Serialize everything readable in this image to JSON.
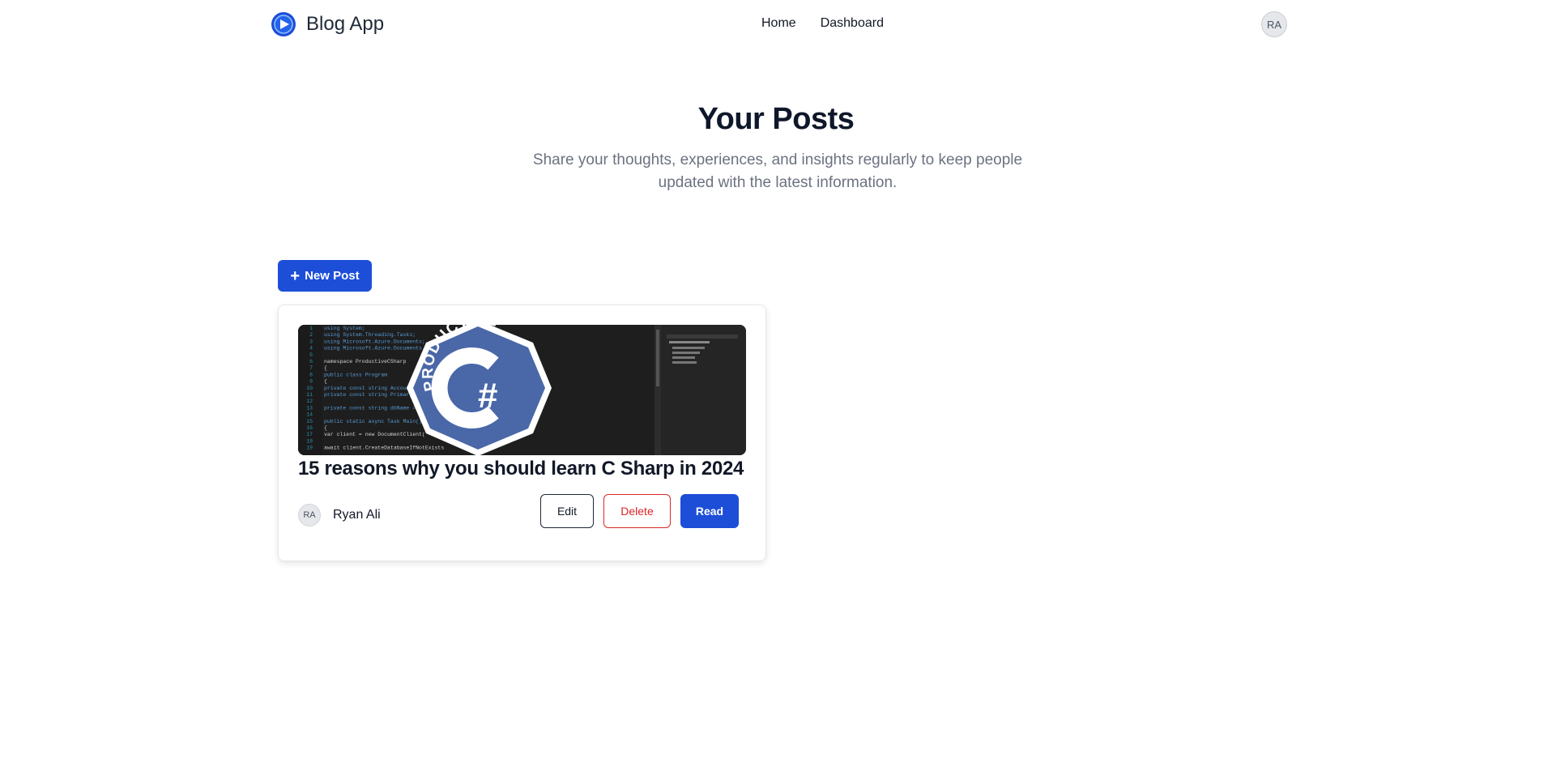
{
  "header": {
    "brand": "Blog App",
    "nav": [
      "Home",
      "Dashboard"
    ],
    "user_initials": "RA"
  },
  "hero": {
    "title": "Your Posts",
    "subtitle": "Share your thoughts, experiences, and insights regularly to keep people updated with the latest information."
  },
  "toolbar": {
    "new_post_label": "New Post"
  },
  "posts": [
    {
      "title": "15 reasons why you should learn C Sharp in 2024",
      "author_initials": "RA",
      "author_name": "Ryan Ali",
      "edit_label": "Edit",
      "delete_label": "Delete",
      "read_label": "Read",
      "thumbnail": {
        "badge_text": "PRODUCTIVE",
        "badge_symbol": "C#",
        "code_lines": [
          "using System;",
          "using System.Threading.Tasks;",
          "using Microsoft.Azure.Documents;",
          "using Microsoft.Azure.Documents.Client;",
          "",
          "namespace ProductiveCSharp",
          "{",
          "  public class Program",
          "  {",
          "    private const string AccountUrl",
          "    private const string PrimaryKey",
          "",
          "    private const string dbName = \"",
          "",
          "    public static async Task Main()",
          "    {",
          "      var client = new DocumentClient(",
          "",
          "      await client.CreateDatabaseIfNotExists"
        ]
      }
    }
  ],
  "colors": {
    "primary": "#1d4ed8",
    "danger": "#dc2626",
    "badge": "#4a67a8"
  }
}
